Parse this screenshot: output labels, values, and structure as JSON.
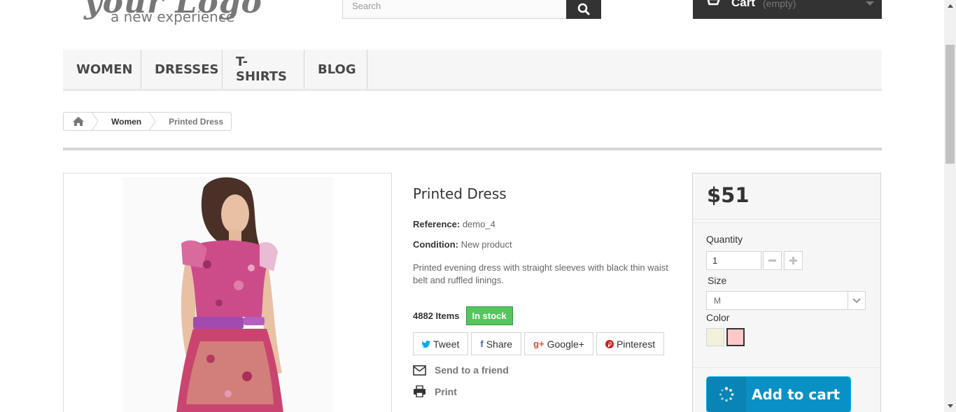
{
  "header": {
    "logo_script": "your Logo",
    "logo_tagline": "a new experience",
    "search_placeholder": "Search",
    "cart_label": "Cart",
    "cart_status": "(empty)"
  },
  "menu": {
    "items": [
      {
        "label": "WOMEN"
      },
      {
        "label": "DRESSES"
      },
      {
        "label": "T-SHIRTS"
      },
      {
        "label": "BLOG"
      }
    ]
  },
  "breadcrumb": {
    "category": "Women",
    "current": "Printed Dress"
  },
  "product": {
    "title": "Printed Dress",
    "reference_label": "Reference:",
    "reference_value": "demo_4",
    "condition_label": "Condition:",
    "condition_value": "New product",
    "description": "Printed evening dress with straight sleeves with black thin waist belt and ruffled linings.",
    "items_count": "4882 Items",
    "stock_status": "In stock",
    "share": {
      "tweet": "Tweet",
      "facebook": "Share",
      "google": "Google+",
      "pinterest": "Pinterest"
    },
    "send_friend": "Send to a friend",
    "print": "Print"
  },
  "buy_box": {
    "price": "$51",
    "quantity_label": "Quantity",
    "quantity_value": "1",
    "size_label": "Size",
    "size_value": "M",
    "color_label": "Color",
    "colors": [
      "#f1f1dc",
      "#fcc8c8"
    ],
    "add_to_cart": "Add to cart"
  },
  "colors": {
    "accent_blue": "#0990c4",
    "stock_green": "#55c65e",
    "dark": "#333333"
  }
}
